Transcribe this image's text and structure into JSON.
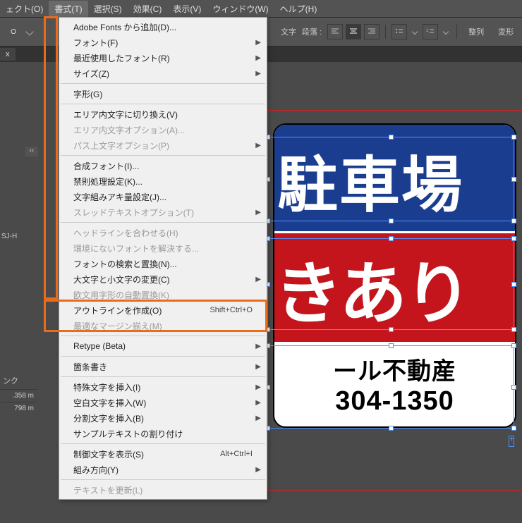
{
  "menubar": {
    "items": [
      "ェクト(O)",
      "書式(T)",
      "選択(S)",
      "効果(C)",
      "表示(V)",
      "ウィンドウ(W)",
      "ヘルプ(H)"
    ],
    "active_index": 1
  },
  "toolbar": {
    "text_label": "文字",
    "para_label": "段落 :",
    "align_btn": "整列",
    "transform_btn": "変形"
  },
  "tab": {
    "close": "x"
  },
  "panel": {
    "handle": "‹‹",
    "label": "ンク",
    "w": ".358 m",
    "h": "798 m"
  },
  "menu": {
    "groups": [
      [
        {
          "label": "Adobe Fonts から追加(D)...",
          "disabled": false
        },
        {
          "label": "フォント(F)",
          "sub": true
        },
        {
          "label": "最近使用したフォント(R)",
          "sub": true
        },
        {
          "label": "サイズ(Z)",
          "sub": true
        }
      ],
      [
        {
          "label": "字形(G)"
        }
      ],
      [
        {
          "label": "エリア内文字に切り換え(V)"
        },
        {
          "label": "エリア内文字オプション(A)...",
          "disabled": true
        },
        {
          "label": "パス上文字オプション(P)",
          "sub": true,
          "disabled": true
        }
      ],
      [
        {
          "label": "合成フォント(I)..."
        },
        {
          "label": "禁則処理設定(K)..."
        },
        {
          "label": "文字組みアキ量設定(J)..."
        },
        {
          "label": "スレッドテキストオプション(T)",
          "sub": true,
          "disabled": true
        }
      ],
      [
        {
          "label": "ヘッドラインを合わせる(H)",
          "disabled": true
        },
        {
          "label": "環境にないフォントを解決する...",
          "disabled": true
        },
        {
          "label": "フォントの検索と置換(N)..."
        },
        {
          "label": "大文字と小文字の変更(C)",
          "sub": true
        },
        {
          "label": "欧文用字形の自動置換(K)",
          "disabled": true
        },
        {
          "label": "アウトラインを作成(O)",
          "shortcut": "Shift+Ctrl+O"
        },
        {
          "label": "最適なマージン揃え(M)",
          "disabled": true
        }
      ],
      [
        {
          "label": "Retype (Beta)",
          "sub": true
        }
      ],
      [
        {
          "label": "箇条書き",
          "sub": true
        }
      ],
      [
        {
          "label": "特殊文字を挿入(I)",
          "sub": true
        },
        {
          "label": "空白文字を挿入(W)",
          "sub": true
        },
        {
          "label": "分割文字を挿入(B)",
          "sub": true
        },
        {
          "label": "サンプルテキストの割り付け"
        }
      ],
      [
        {
          "label": "制御文字を表示(S)",
          "shortcut": "Alt+Ctrl+I"
        },
        {
          "label": "組み方向(Y)",
          "sub": true
        }
      ],
      [
        {
          "label": "テキストを更新(L)",
          "disabled": true
        }
      ]
    ]
  },
  "sign": {
    "top": "駐車場",
    "mid": "きあり",
    "bot1": "ール不動産",
    "bot2": "304-1350"
  },
  "sidepanel2": "SJ-H"
}
